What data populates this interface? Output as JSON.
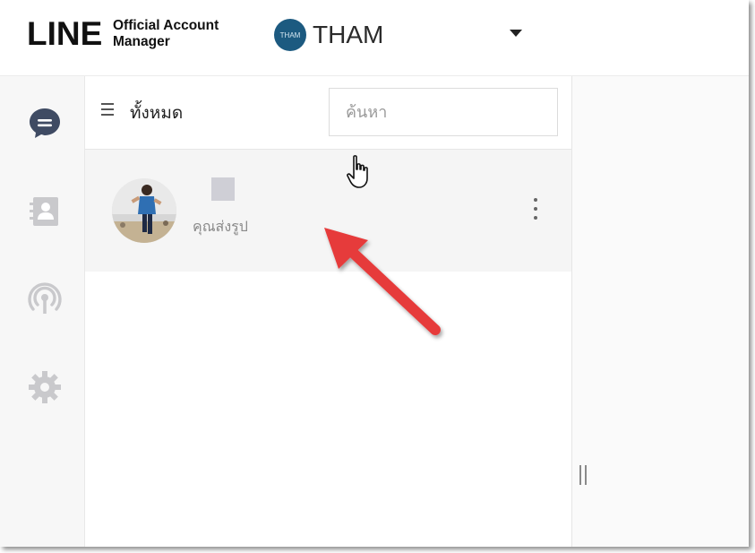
{
  "header": {
    "logo_main": "LINE",
    "logo_sub_line1": "Official Account",
    "logo_sub_line2": "Manager",
    "account_avatar_text": "THAM",
    "account_name": "THAM"
  },
  "sidebar": {
    "items": [
      {
        "icon": "chat-bubble-icon",
        "active": true
      },
      {
        "icon": "contacts-icon",
        "active": false
      },
      {
        "icon": "broadcast-icon",
        "active": false
      },
      {
        "icon": "gear-icon",
        "active": false
      }
    ]
  },
  "chat_list": {
    "filter_label": "ทั้งหมด",
    "search_placeholder": "ค้นหา",
    "items": [
      {
        "preview": "คุณส่งรูป"
      }
    ]
  },
  "colors": {
    "accent_active": "#3f4b63",
    "icon_inactive": "#c9c9cc",
    "annotation_arrow": "#e63b3b",
    "account_avatar": "#1c5a80"
  }
}
